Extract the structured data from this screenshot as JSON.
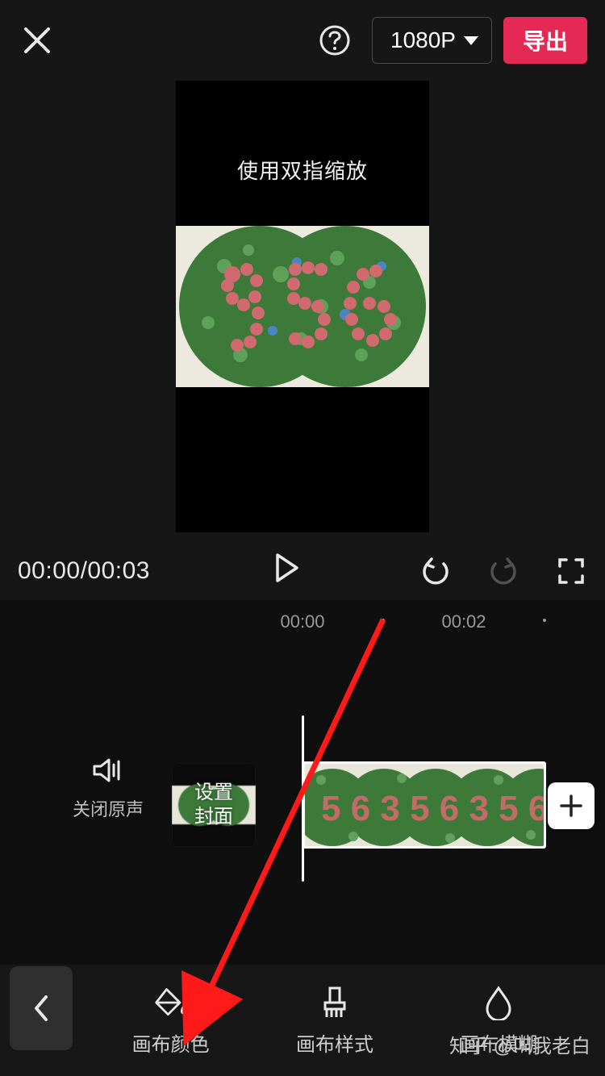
{
  "topbar": {
    "resolution_label": "1080P",
    "export_label": "导出"
  },
  "preview": {
    "hint": "使用双指缩放",
    "digits": "956"
  },
  "playbar": {
    "current": "00:00",
    "separator": "/",
    "total": "00:03"
  },
  "ruler": {
    "t0": "00:00",
    "t1": "00:02"
  },
  "mute": {
    "label": "关闭原声"
  },
  "cover": {
    "line1": "设置",
    "line2": "封面"
  },
  "tools": {
    "canvas_color": "画布颜色",
    "canvas_style": "画布样式",
    "canvas_blur": "画布模糊"
  },
  "watermark": "知乎 @叫我老白"
}
